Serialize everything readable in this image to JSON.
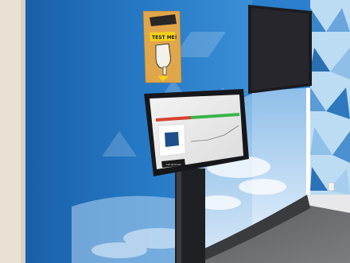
{
  "poster": {
    "badge_text": "TEST ME!"
  },
  "kiosk": {
    "header_text": "",
    "panel_title": "",
    "button_label": "Let Us Know",
    "status_bar_colors": [
      "#d7412e",
      "#39b54a"
    ]
  },
  "colors": {
    "wall_blue": "#1c6fb6",
    "poster_bg": "#e0a64a",
    "poster_badge": "#f5d21a",
    "tv_black": "#1b1b1f",
    "pillar_light": "#cfe6f7"
  }
}
